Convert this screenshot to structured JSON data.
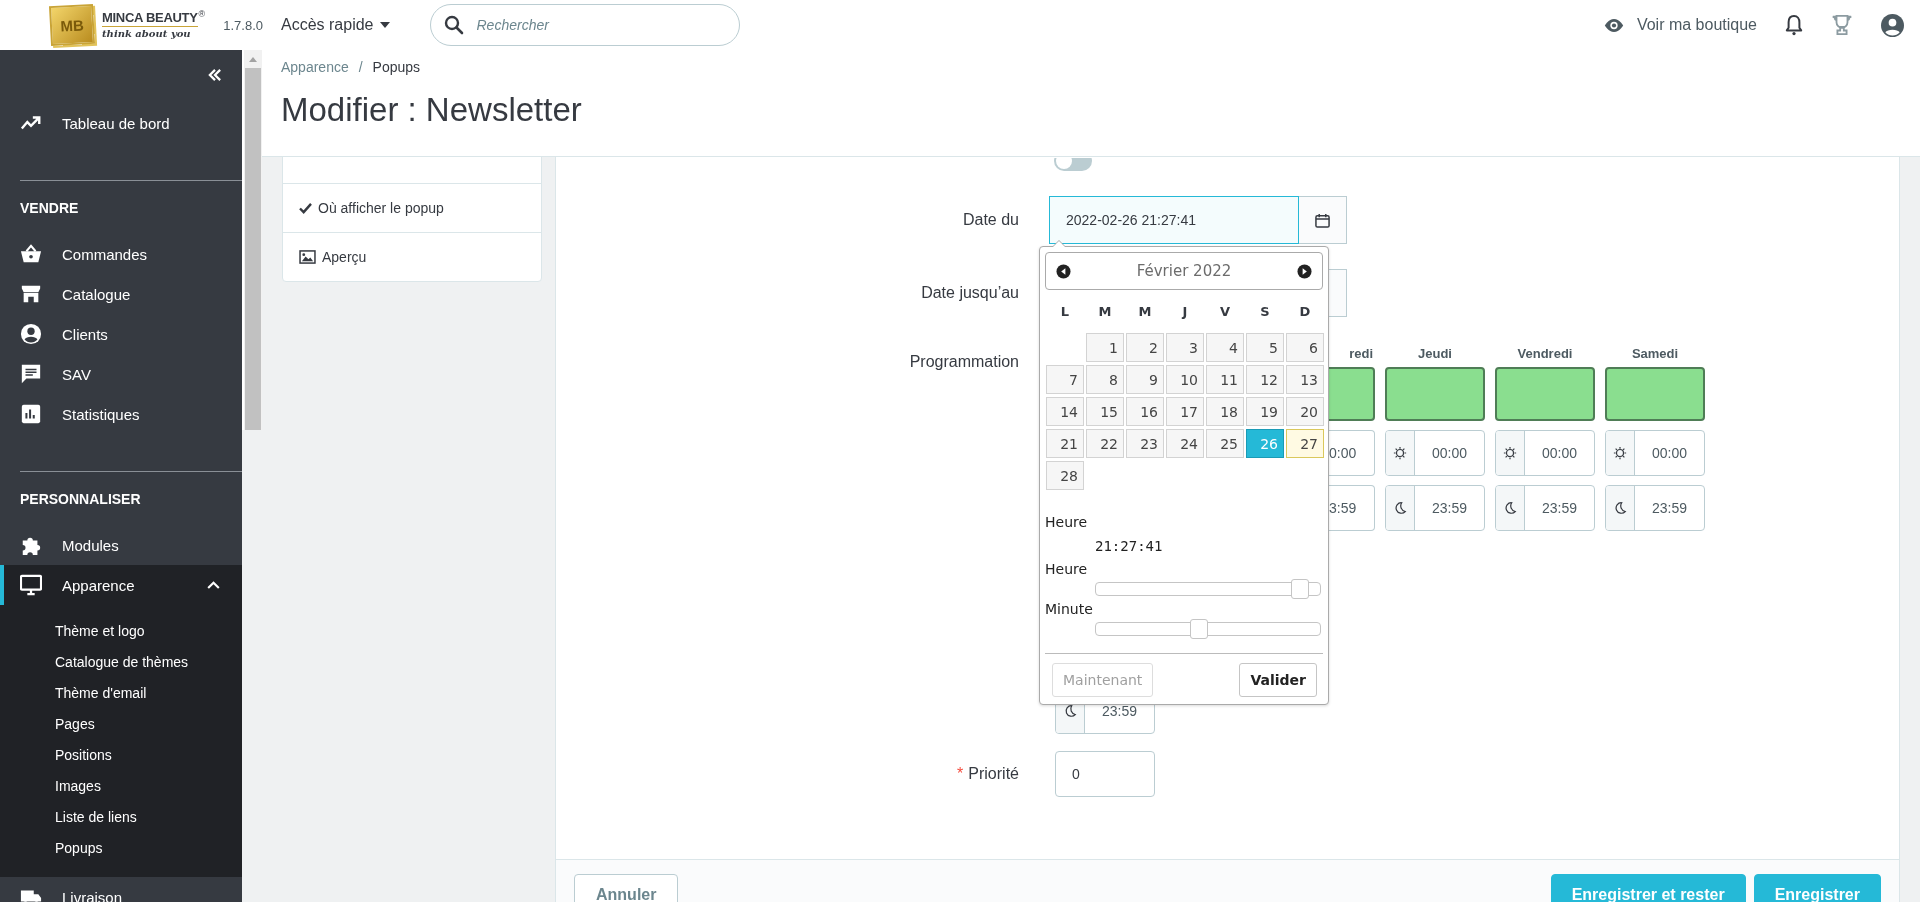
{
  "topbar": {
    "logo": {
      "mark": "MB",
      "name": "MINCA BEAUTY",
      "registered": "®",
      "tagline": "think about you"
    },
    "version": "1.7.8.0",
    "quick_access": "Accès rapide",
    "search": {
      "placeholder": "Rechercher"
    },
    "view_shop": "Voir ma boutique"
  },
  "sidebar": {
    "items": [
      {
        "kind": "link",
        "label": "Tableau de bord",
        "selected": false
      },
      {
        "kind": "section",
        "label": "VENDRE"
      },
      {
        "kind": "link",
        "label": "Commandes",
        "selected": false
      },
      {
        "kind": "link",
        "label": "Catalogue",
        "selected": false
      },
      {
        "kind": "link",
        "label": "Clients",
        "selected": false
      },
      {
        "kind": "link",
        "label": "SAV",
        "selected": false
      },
      {
        "kind": "link",
        "label": "Statistiques",
        "selected": false
      },
      {
        "kind": "section",
        "label": "PERSONNALISER"
      },
      {
        "kind": "link",
        "label": "Modules",
        "selected": false
      },
      {
        "kind": "link",
        "label": "Apparence",
        "selected": true,
        "expanded": true,
        "children": [
          {
            "label": "Thème et logo"
          },
          {
            "label": "Catalogue de thèmes"
          },
          {
            "label": "Thème d'email"
          },
          {
            "label": "Pages"
          },
          {
            "label": "Positions"
          },
          {
            "label": "Images"
          },
          {
            "label": "Liste de liens"
          },
          {
            "label": "Popups"
          }
        ]
      },
      {
        "kind": "link",
        "label": "Livraison",
        "selected": false
      }
    ]
  },
  "breadcrumb": {
    "items": [
      "Apparence",
      "Popups"
    ],
    "separator": "/"
  },
  "page_title": "Modifier : Newsletter",
  "side_tabs": [
    {
      "kind": "check",
      "label": "Où afficher le popup"
    },
    {
      "kind": "image",
      "label": "Aperçu"
    }
  ],
  "form": {
    "active": {
      "on": false
    },
    "date_from": {
      "label": "Date du",
      "value": "2022-02-26 21:27:41"
    },
    "date_to": {
      "label": "Date jusqu’au"
    },
    "schedule": {
      "label": "Programmation",
      "days": [
        {
          "label": "redi",
          "active": true,
          "start": "0:00",
          "end": "3:59"
        },
        {
          "label": "Jeudi",
          "active": true,
          "start": "00:00",
          "end": "23:59"
        },
        {
          "label": "Vendredi",
          "active": true,
          "start": "00:00",
          "end": "23:59"
        },
        {
          "label": "Samedi",
          "active": true,
          "start": "00:00",
          "end": "23:59"
        },
        {
          "end": "23:59"
        }
      ]
    },
    "priority": {
      "label": "Priorité",
      "required_mark": "*",
      "value": "0"
    }
  },
  "datepicker": {
    "month": "Février 2022",
    "weekdays": [
      "L",
      "M",
      "M",
      "J",
      "V",
      "S",
      "D"
    ],
    "weeks": [
      [
        {
          "label": "1",
          "selected": false,
          "today": false
        },
        {
          "label": "2",
          "selected": false,
          "today": false
        },
        {
          "label": "3",
          "selected": false,
          "today": false
        },
        {
          "label": "4",
          "selected": false,
          "today": false
        },
        {
          "label": "5",
          "selected": false,
          "today": false
        },
        {
          "label": "6",
          "selected": false,
          "today": false
        }
      ],
      [
        {
          "label": "7",
          "selected": false,
          "today": false
        },
        {
          "label": "8",
          "selected": false,
          "today": false
        },
        {
          "label": "9",
          "selected": false,
          "today": false
        },
        {
          "label": "10",
          "selected": false,
          "today": false
        },
        {
          "label": "11",
          "selected": false,
          "today": false
        },
        {
          "label": "12",
          "selected": false,
          "today": false
        },
        {
          "label": "13",
          "selected": false,
          "today": false
        }
      ],
      [
        {
          "label": "14",
          "selected": false,
          "today": false
        },
        {
          "label": "15",
          "selected": false,
          "today": false
        },
        {
          "label": "16",
          "selected": false,
          "today": false
        },
        {
          "label": "17",
          "selected": false,
          "today": false
        },
        {
          "label": "18",
          "selected": false,
          "today": false
        },
        {
          "label": "19",
          "selected": false,
          "today": false
        },
        {
          "label": "20",
          "selected": false,
          "today": false
        }
      ],
      [
        {
          "label": "21",
          "selected": false,
          "today": false
        },
        {
          "label": "22",
          "selected": false,
          "today": false
        },
        {
          "label": "23",
          "selected": false,
          "today": false
        },
        {
          "label": "24",
          "selected": false,
          "today": false
        },
        {
          "label": "25",
          "selected": false,
          "today": false
        },
        {
          "label": "26",
          "selected": true,
          "today": false
        },
        {
          "label": "27",
          "selected": false,
          "today": true
        }
      ],
      [
        {
          "label": "28",
          "selected": false,
          "today": false
        }
      ]
    ],
    "time": {
      "label": "Heure",
      "value": "21:27:41"
    },
    "sliders": [
      {
        "label": "Heure",
        "level": 0.91
      },
      {
        "label": "Minute",
        "level": 0.46
      }
    ],
    "now_button": {
      "label": "Maintenant",
      "disabled": true
    },
    "done_button": {
      "label": "Valider"
    }
  },
  "footer": {
    "cancel": "Annuler",
    "save_stay": "Enregistrer et rester",
    "save": "Enregistrer"
  }
}
